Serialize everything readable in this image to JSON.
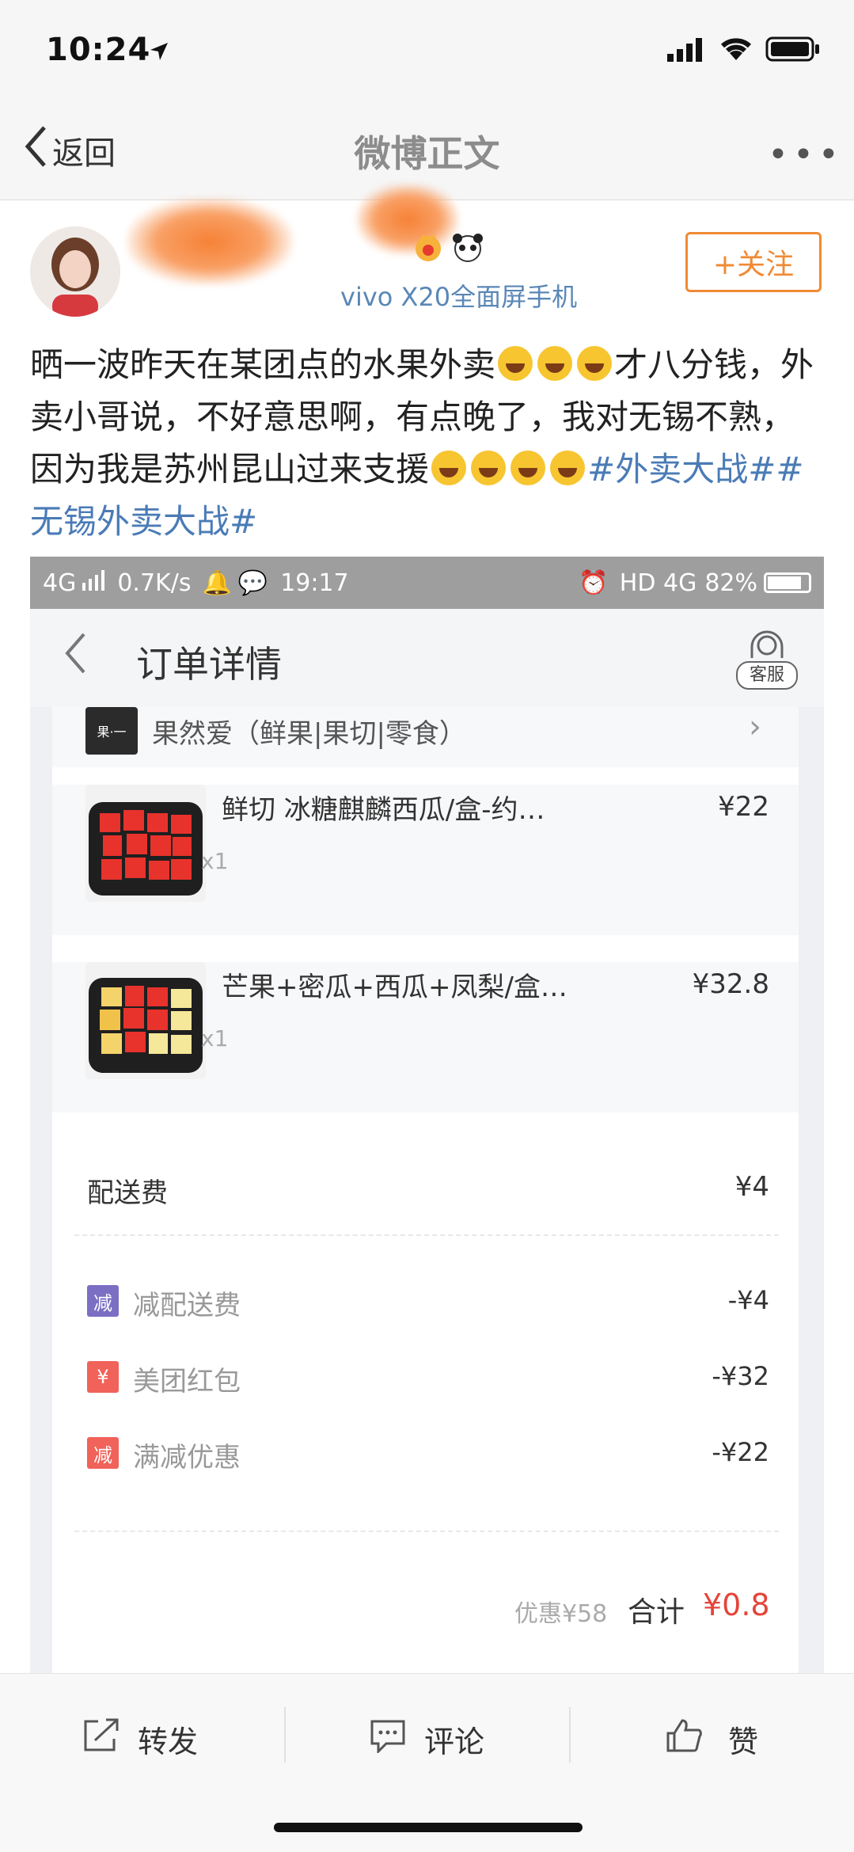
{
  "status_bar": {
    "time": "10:24"
  },
  "nav": {
    "back_label": "返回",
    "title": "微博正文"
  },
  "post": {
    "device": "vivo X20全面屏手机",
    "follow_label": "+关注",
    "text_part1": "晒一波昨天在某团点的水果外卖",
    "text_part2": "才八分钱，外卖小哥说，不好意思啊，有点晚了，我对无锡不熟，因为我是苏州昆山过来支援",
    "tag1": "#外卖大战#",
    "tag2": "#无锡外卖大战#"
  },
  "screenshot": {
    "status": {
      "network": "4G",
      "speed": "0.7K/s",
      "time": "19:17",
      "hd": "HD 4G",
      "battery": "82%"
    },
    "header": {
      "title": "订单详情",
      "service_label": "客服"
    },
    "shop": {
      "name": "果然爱（鲜果|果切|零食）"
    },
    "items": [
      {
        "name": "鲜切 冰糖麒麟西瓜/盒-约…",
        "qty": "x1",
        "price": "¥22"
      },
      {
        "name": "芒果+密瓜+西瓜+凤梨/盒…",
        "qty": "x1",
        "price": "¥32.8"
      }
    ],
    "delivery": {
      "label": "配送费",
      "value": "¥4"
    },
    "discounts": [
      {
        "badge": "减",
        "label": "减配送费",
        "value": "-¥4",
        "color": "#7b6fc4"
      },
      {
        "badge": "¥",
        "label": "美团红包",
        "value": "-¥32",
        "color": "#f0625a"
      },
      {
        "badge": "减",
        "label": "满减优惠",
        "value": "-¥22",
        "color": "#f0625a"
      }
    ],
    "summary": {
      "saved": "优惠¥58",
      "total_label": "合计",
      "total_value": "¥0.8"
    }
  },
  "toolbar": {
    "repost": "转发",
    "comment": "评论",
    "like": "赞"
  },
  "colors": {
    "accent_orange": "#f08a34",
    "link_blue": "#4a7bb6",
    "price_red": "#e5453b"
  }
}
